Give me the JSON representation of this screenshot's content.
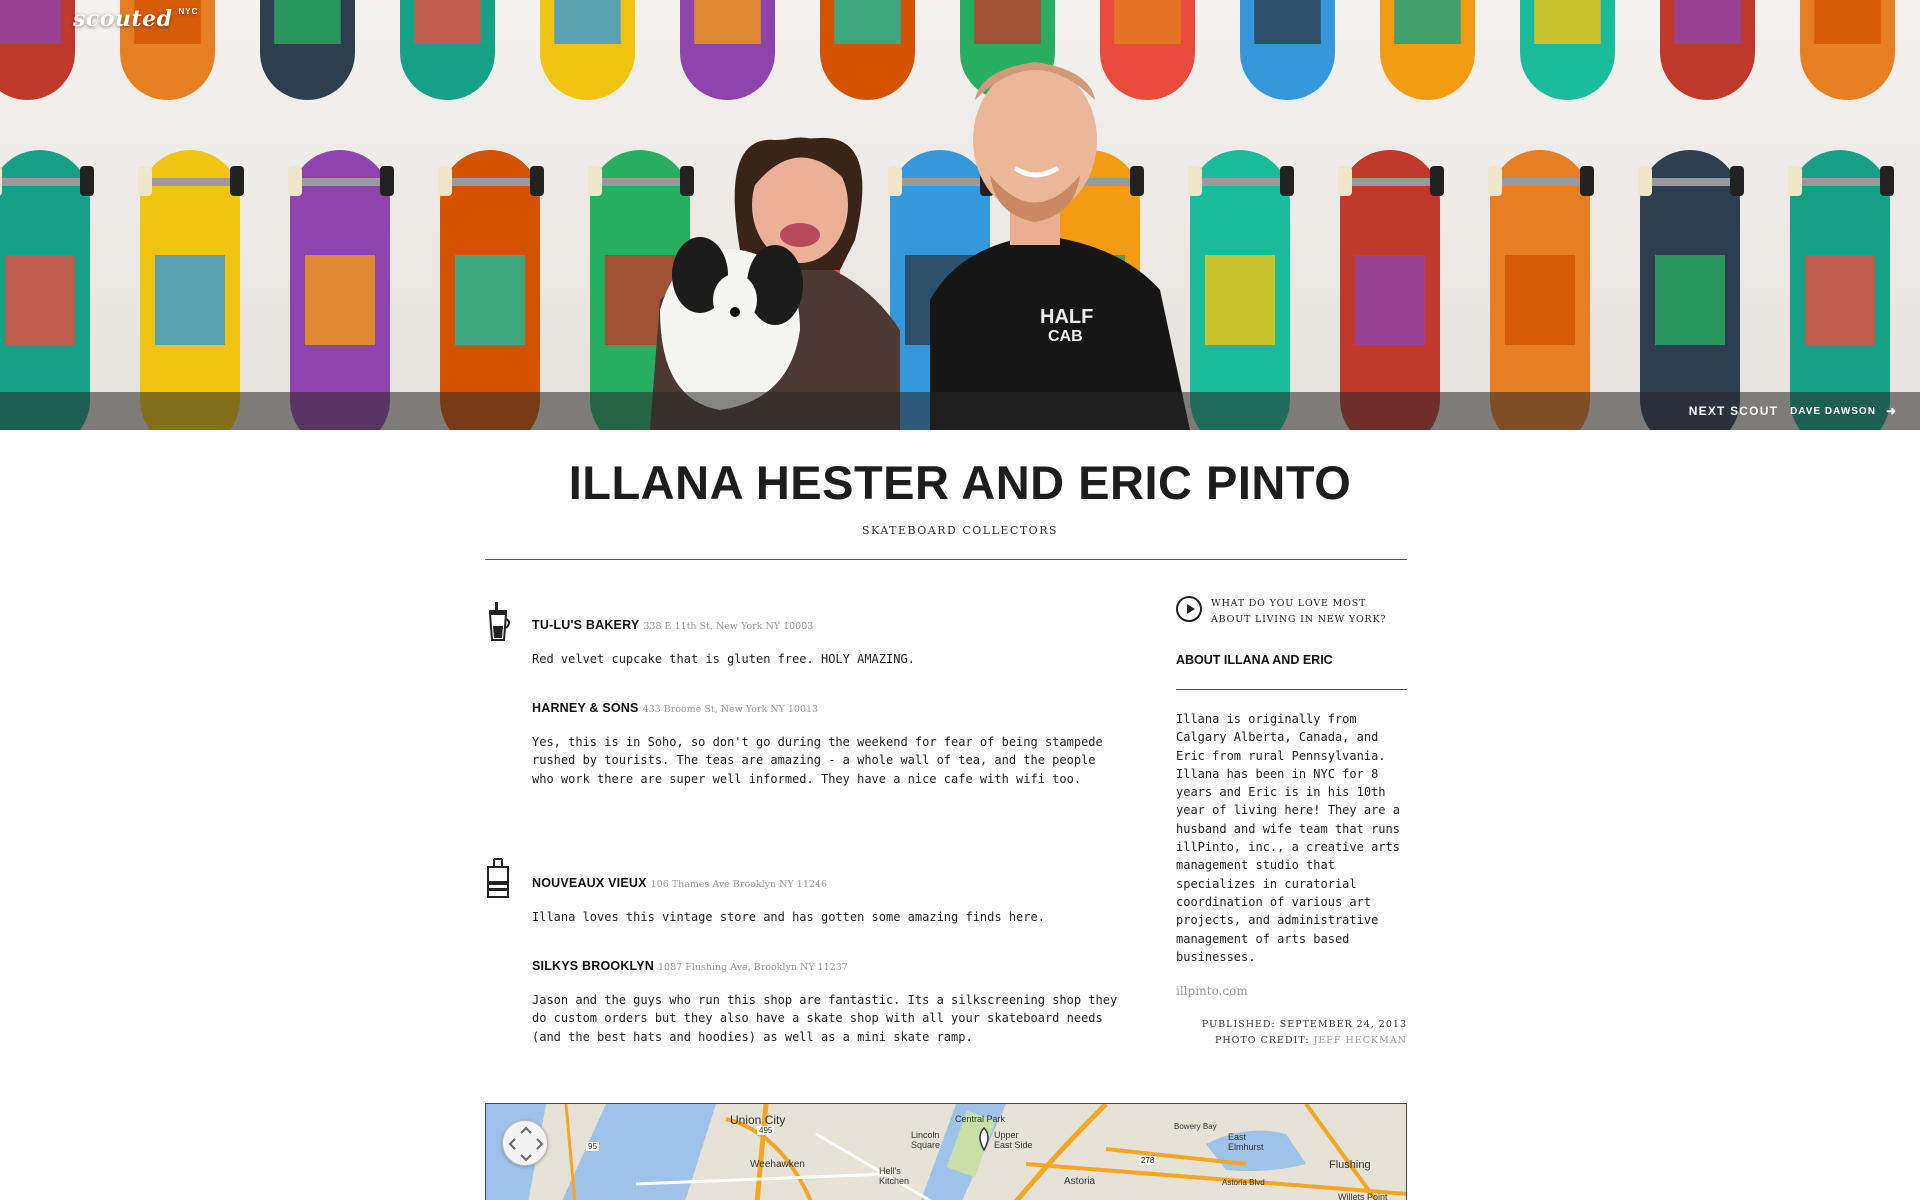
{
  "brand": {
    "logo": "scouted",
    "logo_sup": "NYC"
  },
  "next": {
    "label": "NEXT SCOUT",
    "name": "DAVE DAWSON",
    "arrow": "➜"
  },
  "profile": {
    "title": "ILLANA HESTER AND ERIC PINTO",
    "subtitle": "SKATEBOARD COLLECTORS"
  },
  "groups": [
    {
      "icon": "coffee-cup-icon",
      "places": [
        {
          "name": "TU-LU'S BAKERY",
          "address": "338 E 11th St, New York NY 10003",
          "desc": "Red velvet cupcake that is gluten free. HOLY AMAZING."
        },
        {
          "name": "HARNEY & SONS",
          "address": "433 Broome St, New York NY 10013",
          "desc": "Yes, this is in Soho, so don't go during the weekend for fear of being stampede rushed by tourists. The teas are amazing - a whole wall of tea, and the people who work there are super well informed. They have a nice cafe with wifi too."
        }
      ]
    },
    {
      "icon": "shopping-bag-icon",
      "places": [
        {
          "name": "NOUVEAUX VIEUX",
          "address": "106 Thames Ave Brooklyn NY 11246",
          "desc": "Illana loves this vintage store and has gotten some amazing finds here."
        },
        {
          "name": "SILKYS BROOKLYN",
          "address": "1087 Flushing Ave, Brooklyn NY 11237",
          "desc": "Jason and the guys who run this shop are fantastic. Its a silkscreening shop they do custom orders but they also have a skate shop with all your skateboard needs (and the best hats and hoodies) as well as a mini skate ramp."
        }
      ]
    }
  ],
  "sidebar": {
    "audio_question": "WHAT DO YOU LOVE MOST ABOUT LIVING IN NEW YORK?",
    "about_heading": "ABOUT ILLANA AND ERIC",
    "about_text": "Illana is originally from Calgary Alberta, Canada, and Eric from rural Pennsylvania. Illana has been in NYC for 8 years and Eric is in his 10th year of living here! They are a husband and wife team that runs illPinto, inc., a creative arts management studio that specializes in curatorial coordination of various art projects, and administrative management of arts based businesses.",
    "website": "illpinto.com",
    "published": "PUBLISHED: SEPTEMBER 24, 2013",
    "photo_credit_label": "PHOTO CREDIT:",
    "photo_credit_name": "JEFF HECKMAN"
  },
  "map": {
    "labels": [
      "Union City",
      "Central Park",
      "Upper East Side",
      "Lincoln Square",
      "Hell's Kitchen",
      "Weehawken",
      "Astoria",
      "East Elmhurst",
      "Flushing",
      "Bowery Bay",
      "Astoria Blvd",
      "Willets Point",
      "495",
      "95",
      "278"
    ]
  },
  "colors": {
    "accent_grey": "#999999",
    "text": "#222222",
    "rule": "#555555"
  }
}
